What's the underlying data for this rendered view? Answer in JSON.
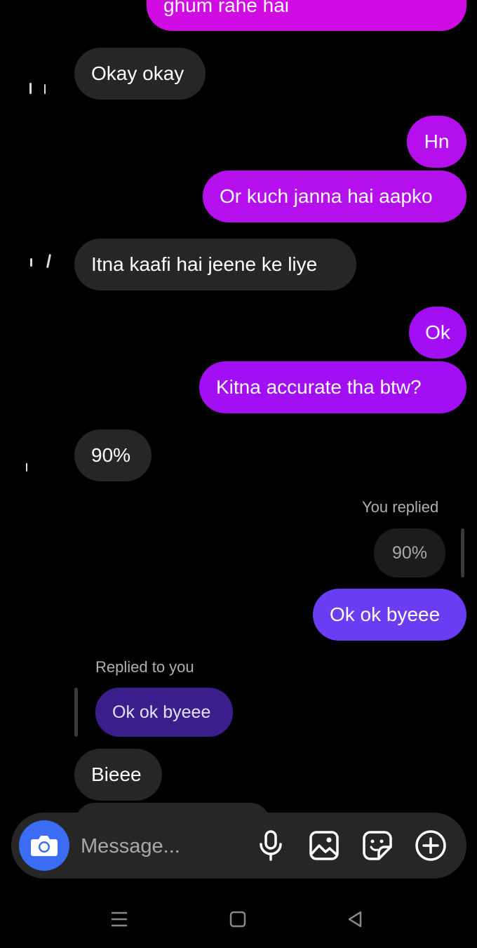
{
  "messages": {
    "m0": "ghum rahe hai",
    "m1": "Okay okay",
    "m2": "Hn",
    "m3": "Or kuch janna hai aapko",
    "m4": "Itna kaafi hai jeene ke liye",
    "m5": "Ok",
    "m6": "Kitna accurate tha btw?",
    "m7": "90%",
    "m8": "Ok ok byeee",
    "m9": "Bieee"
  },
  "reply_you": {
    "label": "You replied",
    "quoted": "90%"
  },
  "reply_them": {
    "label": "Replied to you",
    "quoted": "Ok ok byeee"
  },
  "composer": {
    "placeholder": "Message...",
    "icons": [
      "camera-icon",
      "microphone-icon",
      "gallery-icon",
      "sticker-icon",
      "add-icon"
    ]
  },
  "navbar": {
    "icons": [
      "menu-icon",
      "home-icon",
      "back-icon"
    ]
  },
  "colors": {
    "received_bubble": "#262626",
    "sent_gradient_top": "#d10be4",
    "sent_gradient_bottom": "#6a3cf4",
    "camera_button": "#3b6cf6",
    "reply_quote_bg": "#3a1f8c"
  }
}
